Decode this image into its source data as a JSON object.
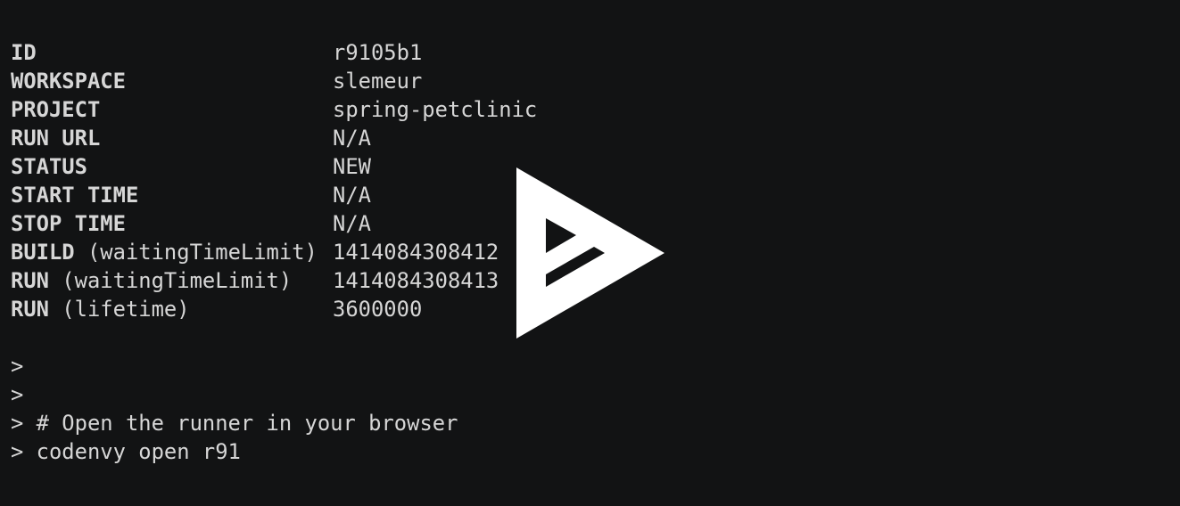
{
  "rows": [
    {
      "key": "ID",
      "param": "",
      "value": "r9105b1"
    },
    {
      "key": "WORKSPACE",
      "param": "",
      "value": "slemeur"
    },
    {
      "key": "PROJECT",
      "param": "",
      "value": "spring-petclinic"
    },
    {
      "key": "RUN URL",
      "param": "",
      "value": "N/A"
    },
    {
      "key": "STATUS",
      "param": "",
      "value": "NEW"
    },
    {
      "key": "START TIME",
      "param": "",
      "value": "N/A"
    },
    {
      "key": "STOP TIME",
      "param": "",
      "value": "N/A"
    },
    {
      "key": "BUILD",
      "param": " (waitingTimeLimit)",
      "value": "1414084308412"
    },
    {
      "key": "RUN",
      "param": " (waitingTimeLimit)",
      "value": "1414084308413"
    },
    {
      "key": "RUN",
      "param": " (lifetime)",
      "value": "3600000"
    }
  ],
  "prompt_lines": [
    ">",
    ">",
    "> # Open the runner in your browser",
    "> codenvy open r91"
  ],
  "colors": {
    "background": "#121314",
    "text": "#d6d6d6",
    "icon": "#ffffff"
  },
  "icons": {
    "overlay": "asciinema-play-icon"
  }
}
